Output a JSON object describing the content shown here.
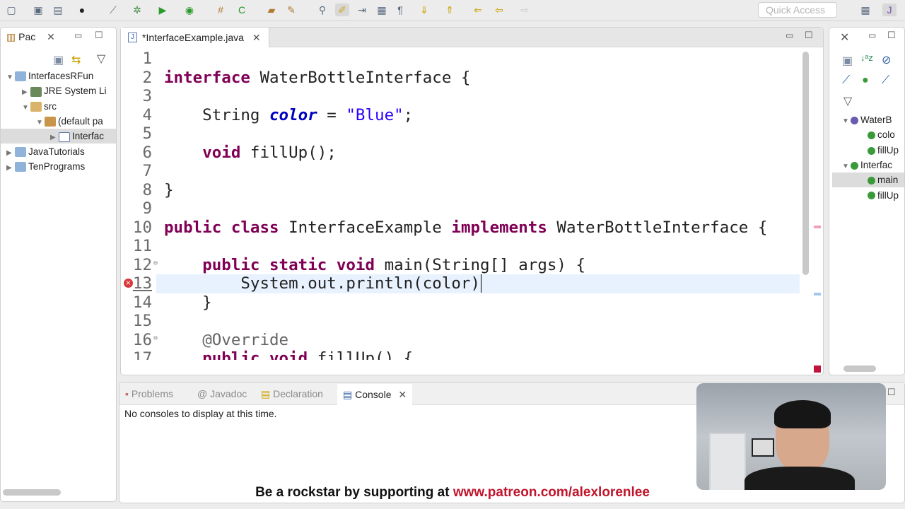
{
  "toolbar": {
    "quick_access_placeholder": "Quick Access"
  },
  "package_explorer": {
    "tab_label": "Pac",
    "items": [
      {
        "label": "InterfacesRFun",
        "expanded": true,
        "icon": "project-icon"
      },
      {
        "label": "JRE System Li",
        "expanded": false,
        "icon": "library-icon"
      },
      {
        "label": "src",
        "expanded": true,
        "icon": "source-folder-icon"
      },
      {
        "label": "(default pa",
        "expanded": true,
        "icon": "package-icon"
      },
      {
        "label": "Interfac",
        "expanded": false,
        "icon": "java-file-icon",
        "selected": true
      },
      {
        "label": "JavaTutorials",
        "expanded": false,
        "icon": "project-icon"
      },
      {
        "label": "TenPrograms",
        "expanded": false,
        "icon": "project-icon"
      }
    ]
  },
  "editor": {
    "tab_label": "*InterfaceExample.java",
    "current_line": 13,
    "error_line": 13,
    "lines": [
      [],
      [
        [
          "interface",
          "kw"
        ],
        [
          " WaterBottleInterface {",
          ""
        ]
      ],
      [],
      [
        [
          "    String ",
          ""
        ],
        [
          "color",
          "fld"
        ],
        [
          " = ",
          ""
        ],
        [
          "\"Blue\"",
          "str"
        ],
        [
          ";",
          ""
        ]
      ],
      [],
      [
        [
          "    ",
          ""
        ],
        [
          "void",
          "kw"
        ],
        [
          " fillUp();",
          ""
        ]
      ],
      [],
      [
        [
          "}",
          ""
        ]
      ],
      [],
      [
        [
          "public",
          "kw"
        ],
        [
          " ",
          ""
        ],
        [
          "class",
          "kw"
        ],
        [
          " InterfaceExample ",
          ""
        ],
        [
          "implements",
          "kw"
        ],
        [
          " WaterBottleInterface {",
          ""
        ]
      ],
      [],
      [
        [
          "    ",
          ""
        ],
        [
          "public",
          "kw"
        ],
        [
          " ",
          ""
        ],
        [
          "static",
          "kw"
        ],
        [
          " ",
          ""
        ],
        [
          "void",
          "kw"
        ],
        [
          " main(String[] args) {",
          ""
        ]
      ],
      [
        [
          "        System.out.println(color)",
          ""
        ]
      ],
      [
        [
          "    }",
          ""
        ]
      ],
      [],
      [
        [
          "    ",
          ""
        ],
        [
          "@Override",
          "ann"
        ]
      ],
      [
        [
          "    ",
          ""
        ],
        [
          "public",
          "kw"
        ],
        [
          " ",
          ""
        ],
        [
          "void",
          "kw"
        ],
        [
          " fillUp() {",
          ""
        ]
      ]
    ]
  },
  "outline": {
    "items": [
      {
        "label": "WaterB",
        "icon": "interface-icon"
      },
      {
        "label": "colo",
        "icon": "field-icon"
      },
      {
        "label": "fillUp",
        "icon": "method-icon"
      },
      {
        "label": "Interfac",
        "icon": "class-icon"
      },
      {
        "label": "main",
        "icon": "method-icon",
        "selected": true
      },
      {
        "label": "fillUp",
        "icon": "method-icon"
      }
    ]
  },
  "bottom": {
    "tabs": [
      {
        "label": "Problems"
      },
      {
        "label": "Javadoc"
      },
      {
        "label": "Declaration"
      },
      {
        "label": "Console",
        "active": true
      }
    ],
    "console_message": "No consoles to display at this time."
  },
  "banner": {
    "text": "Be a rockstar by supporting at",
    "link": "www.patreon.com/alexlorenlee"
  },
  "colors": {
    "keyword": "#7f0055",
    "field": "#0000c0",
    "string": "#2a00ff",
    "banner_link": "#c0142b"
  }
}
